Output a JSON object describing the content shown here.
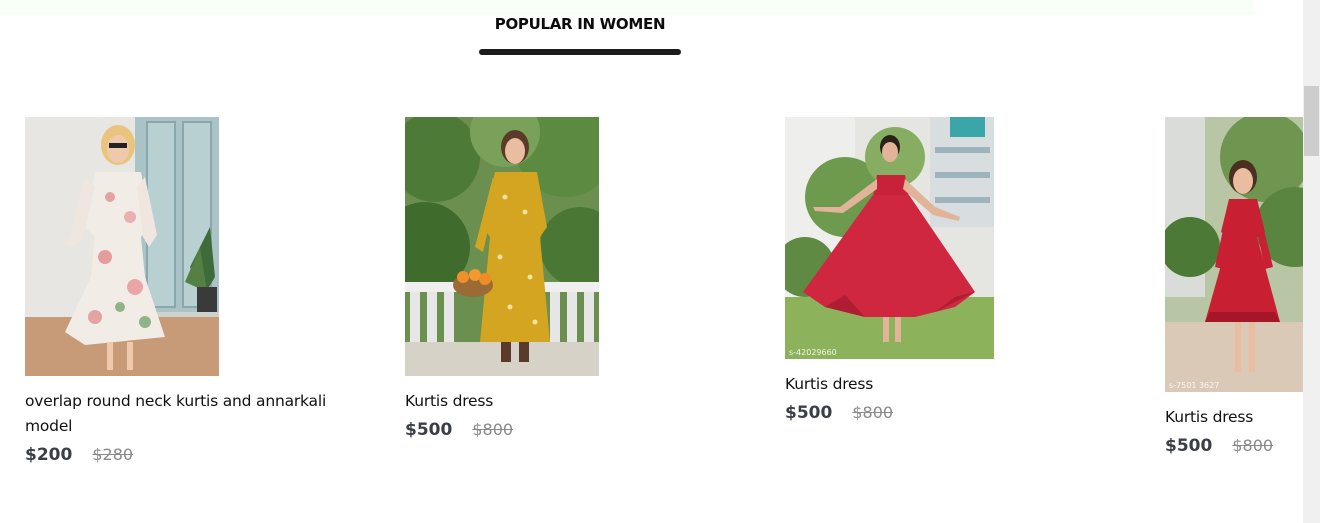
{
  "section": {
    "title": "POPULAR IN WOMEN"
  },
  "products": [
    {
      "name": "overlap round neck kurtis and annarkali model",
      "price": "$200",
      "old_price": "$280",
      "image_watermark": ""
    },
    {
      "name": "Kurtis dress",
      "price": "$500",
      "old_price": "$800",
      "image_watermark": ""
    },
    {
      "name": "Kurtis dress",
      "price": "$500",
      "old_price": "$800",
      "image_watermark": "s-42029660"
    },
    {
      "name": "Kurtis dress",
      "price": "$500",
      "old_price": "$800",
      "image_watermark": "s-7501 3627"
    }
  ],
  "colors": {
    "title": "#0c0c0c",
    "underline": "#1c1c1c",
    "price": "#3a3f47",
    "old_price": "#8a8a8a"
  },
  "icons": {
    "product_images": [
      "floral-dress-photo",
      "yellow-dress-photo",
      "red-dress-photo",
      "red-midi-dress-photo"
    ]
  }
}
